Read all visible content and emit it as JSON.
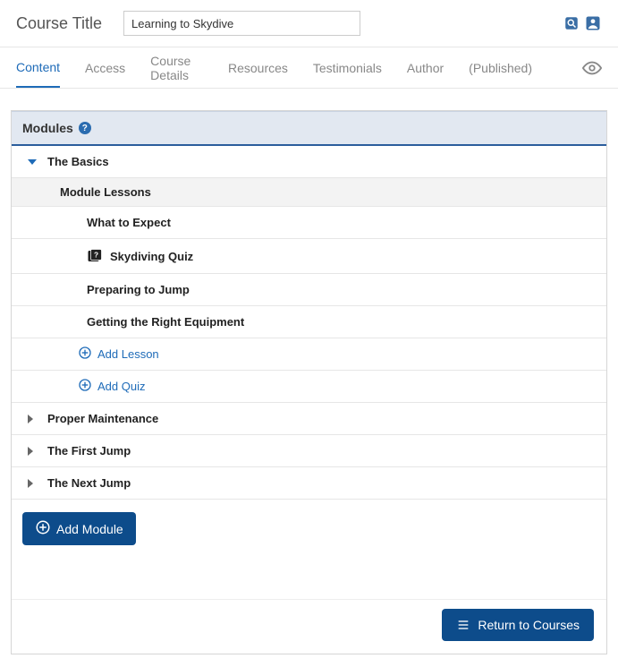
{
  "header": {
    "label": "Course Title",
    "value": "Learning to Skydive"
  },
  "tabs": {
    "content": "Content",
    "access": "Access",
    "details": "Course Details",
    "resources": "Resources",
    "testimonials": "Testimonials",
    "author": "Author",
    "published": "(Published)"
  },
  "panel": {
    "title": "Modules",
    "lessons_header": "Module Lessons",
    "add_lesson": "Add Lesson",
    "add_quiz": "Add Quiz",
    "add_module": "Add Module"
  },
  "modules": [
    {
      "title": "The Basics",
      "expanded": true
    },
    {
      "title": "Proper Maintenance",
      "expanded": false
    },
    {
      "title": "The First Jump",
      "expanded": false
    },
    {
      "title": "The Next Jump",
      "expanded": false
    }
  ],
  "lessons": [
    {
      "title": "What to Expect",
      "type": "lesson"
    },
    {
      "title": "Skydiving Quiz",
      "type": "quiz"
    },
    {
      "title": "Preparing to Jump",
      "type": "lesson"
    },
    {
      "title": "Getting the Right Equipment",
      "type": "lesson"
    }
  ],
  "footer": {
    "return": "Return to Courses"
  }
}
